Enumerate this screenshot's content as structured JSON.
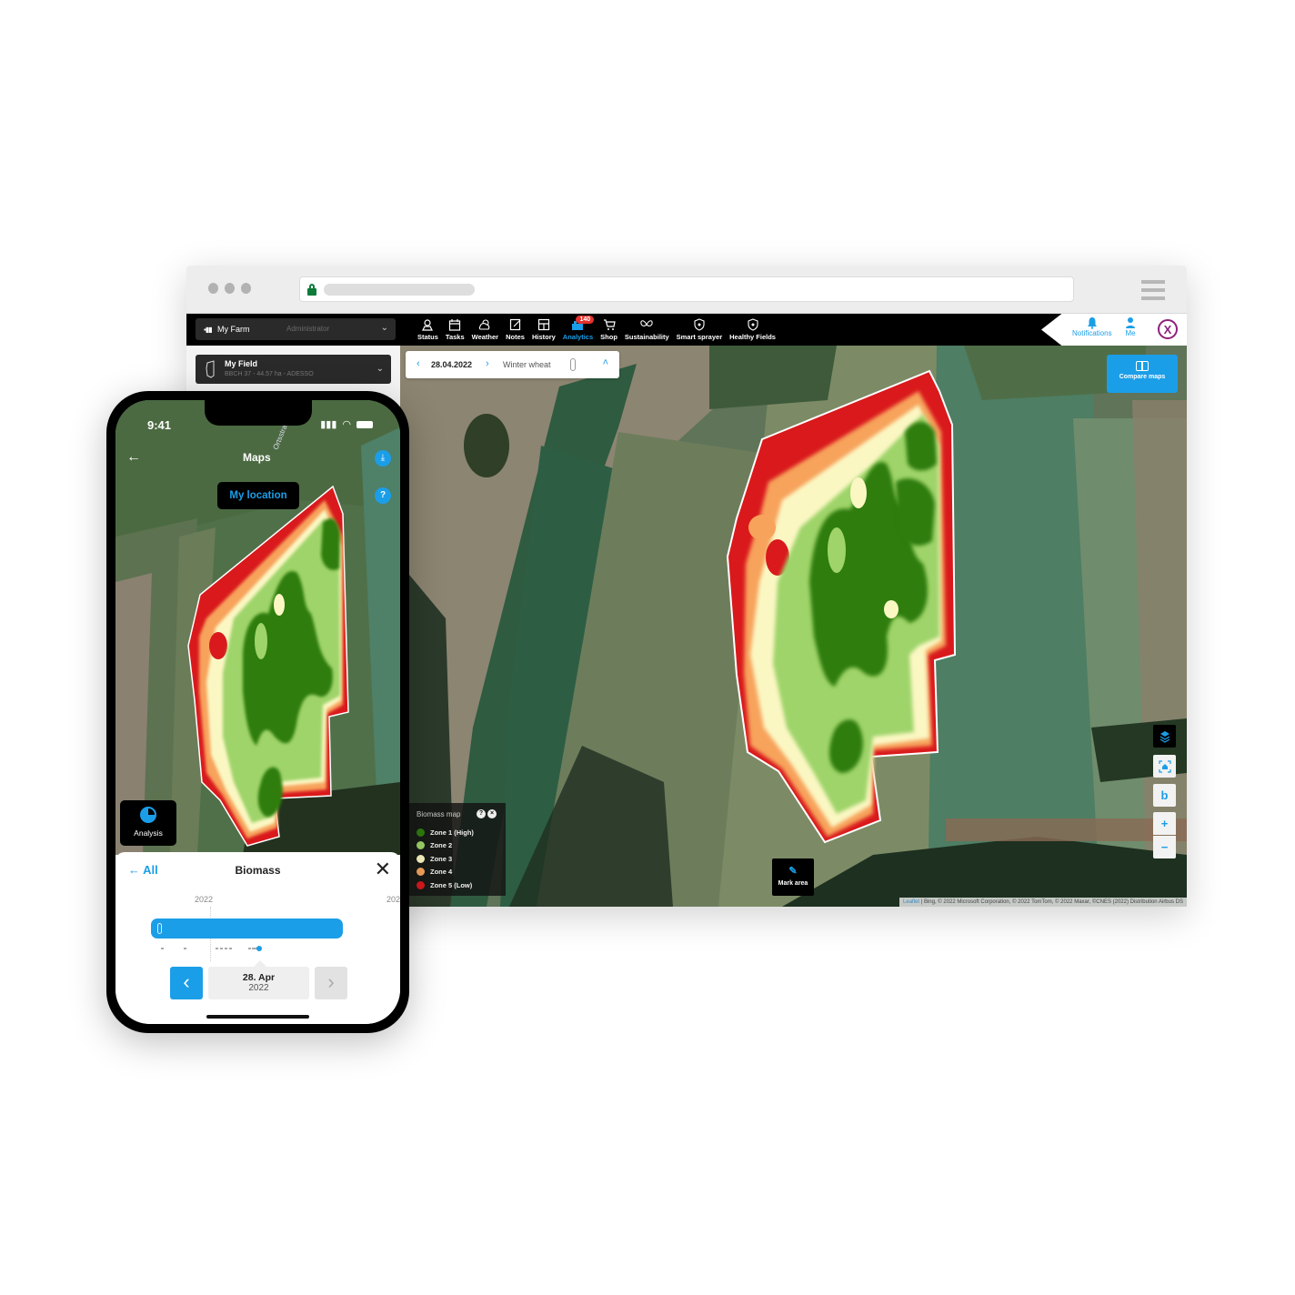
{
  "browser": {
    "url_secure": true
  },
  "appbar": {
    "farm_name": "My Farm",
    "farm_role": "Administrator",
    "nav": [
      {
        "label": "Status",
        "icon": "status-icon",
        "active": false
      },
      {
        "label": "Tasks",
        "icon": "calendar-icon",
        "active": false
      },
      {
        "label": "Weather",
        "icon": "weather-icon",
        "active": false
      },
      {
        "label": "Notes",
        "icon": "notes-icon",
        "active": false
      },
      {
        "label": "History",
        "icon": "history-icon",
        "active": false
      },
      {
        "label": "Analytics",
        "icon": "analytics-icon",
        "active": true,
        "badge": "140"
      },
      {
        "label": "Shop",
        "icon": "cart-icon",
        "active": false
      },
      {
        "label": "Sustainability",
        "icon": "butterfly-icon",
        "active": false
      },
      {
        "label": "Smart sprayer",
        "icon": "shield-icon",
        "active": false
      },
      {
        "label": "Healthy Fields",
        "icon": "shield-icon",
        "active": false
      }
    ],
    "notifications_label": "Notifications",
    "me_label": "Me",
    "logo_glyph": "X"
  },
  "field": {
    "name": "My Field",
    "meta": "BBCH 37 - 44.57 ha - ADESSO"
  },
  "datebar": {
    "date": "28.04.2022",
    "crop": "Winter wheat"
  },
  "map": {
    "compare_label": "Compare maps",
    "mark_area_label": "Mark area",
    "controls": [
      "layers",
      "home",
      "bing",
      "+",
      "−"
    ],
    "attribution_link": "Leaflet",
    "attribution_text": " | Bing, © 2022 Microsoft Corporation, © 2022 TomTom, © 2022 Maxar, ©CNES (2022) Distribution Airbus DS"
  },
  "legend": {
    "title": "Biomass map",
    "zones": [
      {
        "label": "Zone 1 (High)",
        "color": "#2e7d0c"
      },
      {
        "label": "Zone 2",
        "color": "#9fd46a"
      },
      {
        "label": "Zone 3",
        "color": "#fbf7c3"
      },
      {
        "label": "Zone 4",
        "color": "#f7a35c"
      },
      {
        "label": "Zone 5 (Low)",
        "color": "#d9191c"
      }
    ]
  },
  "colors": {
    "accent": "#1b9ee8",
    "badge": "#e5322d",
    "brand": "#8e1f7e"
  },
  "phone": {
    "time": "9:41",
    "title": "Maps",
    "road_label": "Ortsstraße",
    "my_location": "My location",
    "analysis_label": "Analysis",
    "sheet": {
      "back_label": "All",
      "title": "Biomass",
      "year_left": "2022",
      "year_right": "202",
      "date_day": "28. Apr",
      "date_year": "2022"
    }
  }
}
